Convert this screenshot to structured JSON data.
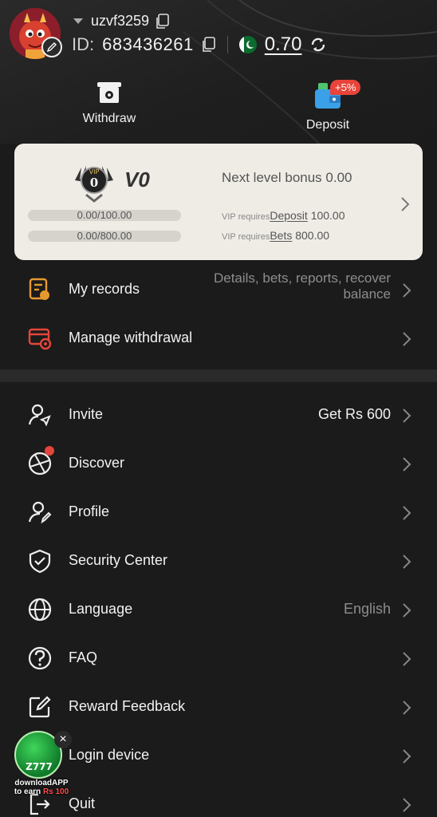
{
  "header": {
    "username": "uzvf3259",
    "id_label": "ID:",
    "id_value": "683436261",
    "balance": "0.70",
    "avatar_icon": "dragon-avatar-icon",
    "edit_icon": "edit-pen-icon",
    "copy_icon": "copy-icon",
    "refresh_icon": "refresh-icon",
    "flag_icon": "pakistan-flag-icon"
  },
  "actions": {
    "withdraw_label": "Withdraw",
    "deposit_label": "Deposit",
    "deposit_badge": "+5%"
  },
  "vip": {
    "level": "V0",
    "emblem_label": "VIP",
    "emblem_level": "0",
    "next_bonus": "Next level bonus 0.00",
    "deposit_progress": "0.00/100.00",
    "bets_progress": "0.00/800.00",
    "deposit_progress_fraction": 0,
    "bets_progress_fraction": 0,
    "req_prefix": "VIP requires",
    "deposit_link": "Deposit",
    "deposit_amount": "100.00",
    "bets_link": "Bets",
    "bets_amount": "800.00"
  },
  "menu_top": [
    {
      "label": "My records",
      "desc": "Details, bets, reports, recover balance",
      "icon": "records-icon"
    },
    {
      "label": "Manage withdrawal",
      "icon": "manage-withdrawal-icon"
    }
  ],
  "menu": [
    {
      "label": "Invite",
      "value": "Get Rs 600",
      "icon": "invite-icon"
    },
    {
      "label": "Discover",
      "icon": "discover-icon"
    },
    {
      "label": "Profile",
      "icon": "profile-icon"
    },
    {
      "label": "Security Center",
      "icon": "shield-icon"
    },
    {
      "label": "Language",
      "value": "English",
      "icon": "globe-icon"
    },
    {
      "label": "FAQ",
      "icon": "question-icon"
    },
    {
      "label": "Reward Feedback",
      "icon": "feedback-icon"
    },
    {
      "label": "Login device",
      "icon": "device-icon"
    },
    {
      "label": "Quit",
      "icon": "logout-icon"
    }
  ],
  "promo": {
    "brand": "Z777",
    "line1": "downloadAPP",
    "line2_prefix": "to earn ",
    "line2_amount": "Rs 100",
    "close": "×"
  },
  "colors": {
    "background": "#1b1b1b",
    "card": "#efece6",
    "accent_orange": "#e69a2e",
    "accent_red": "#e5453a",
    "text_muted": "#8d8d8d"
  }
}
